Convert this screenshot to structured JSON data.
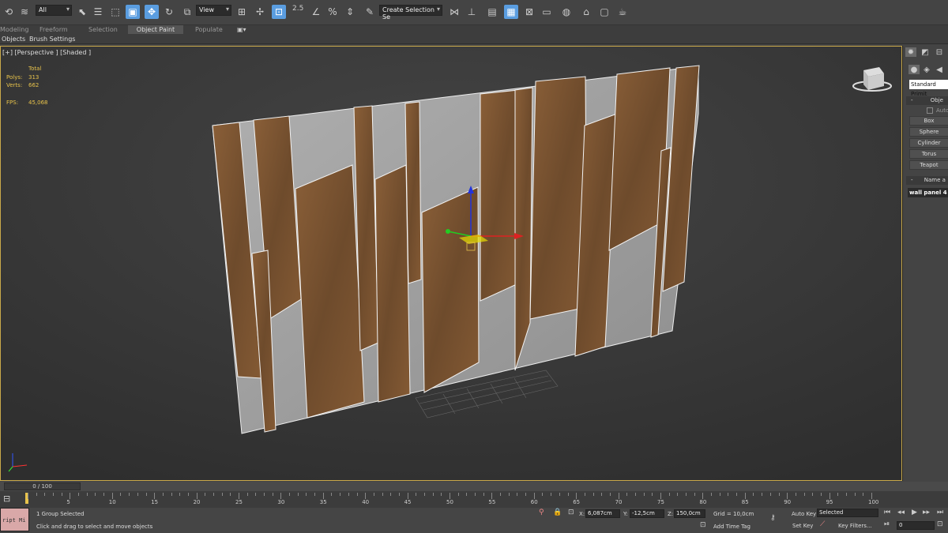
{
  "toolbar": {
    "selection_filter": "All",
    "reference_coord": "View",
    "snap_label": "2.5",
    "named_selection_placeholder": "Create Selection Se"
  },
  "ribbon": {
    "tabs": [
      "Modeling",
      "Freeform",
      "Selection",
      "Object Paint",
      "Populate"
    ],
    "active_tab": "Object Paint",
    "sub_tabs": [
      "Objects",
      "Brush Settings"
    ]
  },
  "viewport": {
    "label": "[+] [Perspective ] [Shaded ]",
    "stats": {
      "header": "Total",
      "polys_label": "Polys:",
      "polys_value": "313",
      "verts_label": "Verts:",
      "verts_value": "662",
      "fps_label": "FPS:",
      "fps_value": "45,068"
    }
  },
  "command_panel": {
    "category_dropdown": "Standard Primit",
    "object_type_header": "Obje",
    "autogrid_label": "Auto",
    "buttons": [
      "Box",
      "Sphere",
      "Cylinder",
      "Torus",
      "Teapot"
    ],
    "name_header": "Name a",
    "object_name": "wall panel 4"
  },
  "time_slider": {
    "frame_display": "0 / 100",
    "ticks": [
      "5",
      "10",
      "15",
      "20",
      "25",
      "30",
      "35",
      "40",
      "45",
      "50",
      "55",
      "60",
      "65",
      "70",
      "75",
      "80",
      "85",
      "90",
      "95",
      "100"
    ]
  },
  "status_bar": {
    "maxscript": "ript Mi",
    "selection_status": "1 Group Selected",
    "prompt": "Click and drag to select and move objects",
    "x_label": "X:",
    "x_value": "6,087cm",
    "y_label": "Y:",
    "y_value": "-12,5cm",
    "z_label": "Z:",
    "z_value": "150,0cm",
    "grid": "Grid = 10,0cm",
    "add_time_tag": "Add Time Tag",
    "auto_key": "Auto Key",
    "set_key": "Set Key",
    "key_mode": "Selected",
    "key_filters": "Key Filters...",
    "current_frame": "0"
  },
  "colors": {
    "accent": "#5a9de0",
    "viewport_border": "#c9a94a",
    "stats_text": "#e8c34b",
    "wood": "#7a5634",
    "concrete": "#a3a3a3"
  }
}
